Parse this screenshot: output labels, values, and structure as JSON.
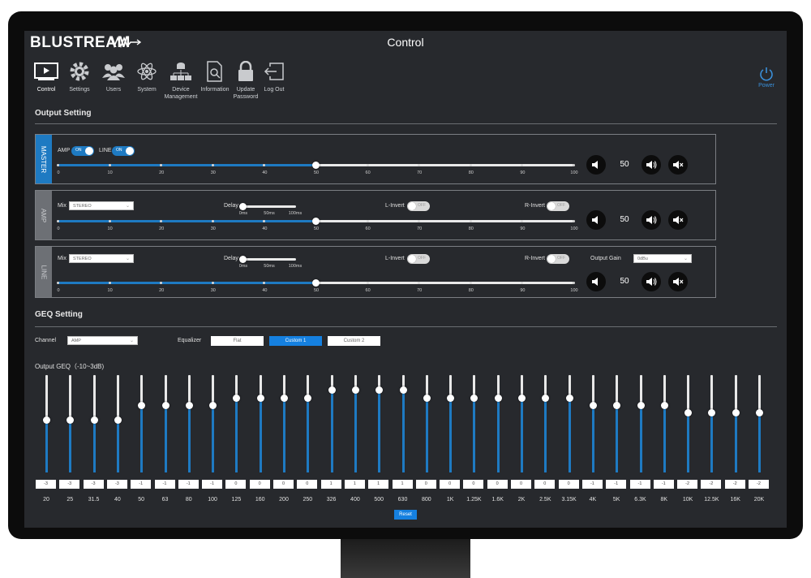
{
  "app": {
    "logo": "BLUSTREAM",
    "title": "Control"
  },
  "nav": [
    {
      "label": "Control",
      "icon": "monitor-play-icon"
    },
    {
      "label": "Settings",
      "icon": "gear-icon"
    },
    {
      "label": "Users",
      "icon": "users-icon"
    },
    {
      "label": "System",
      "icon": "atom-icon"
    },
    {
      "label": "Device Management",
      "icon": "network-icon"
    },
    {
      "label": "Information",
      "icon": "document-search-icon"
    },
    {
      "label": "Update Password",
      "icon": "lock-icon"
    },
    {
      "label": "Log Out",
      "icon": "logout-icon"
    }
  ],
  "power": {
    "label": "Power",
    "icon": "power-icon"
  },
  "output_setting": {
    "title": "Output Setting",
    "scale_ticks": [
      "0",
      "10",
      "20",
      "30",
      "40",
      "50",
      "60",
      "70",
      "80",
      "90",
      "100"
    ],
    "master": {
      "tab": "MASTER",
      "amp_label": "AMP",
      "amp_toggle": "ON",
      "line_label": "LINE",
      "line_toggle": "ON",
      "volume": "50"
    },
    "amp": {
      "tab": "AMP",
      "mix_label": "Mix",
      "mix_value": "STEREO",
      "delay_label": "Delay",
      "delay_ticks": [
        "0ms",
        "50ms",
        "100ms"
      ],
      "l_invert_label": "L-Invert",
      "l_invert_toggle": "OFF",
      "r_invert_label": "R-Invert",
      "r_invert_toggle": "OFF",
      "volume": "50"
    },
    "line": {
      "tab": "LINE",
      "mix_label": "Mix",
      "mix_value": "STEREO",
      "delay_label": "Delay",
      "delay_ticks": [
        "0ms",
        "50ms",
        "100ms"
      ],
      "l_invert_label": "L-Invert",
      "l_invert_toggle": "OFF",
      "r_invert_label": "R-Invert",
      "r_invert_toggle": "OFF",
      "output_gain_label": "Output Gain",
      "output_gain_value": "0dBu",
      "volume": "50"
    }
  },
  "geq": {
    "title": "GEQ Setting",
    "channel_label": "Channel",
    "channel_value": "AMP",
    "equalizer_label": "Equalizer",
    "presets": [
      "Flat",
      "Custom 1",
      "Custom 2"
    ],
    "active_preset": "Custom 1",
    "output_label": "Output GEQ（-10~3dB)",
    "bands": [
      {
        "freq": "20",
        "value": "-3"
      },
      {
        "freq": "25",
        "value": "-3"
      },
      {
        "freq": "31.5",
        "value": "-3"
      },
      {
        "freq": "40",
        "value": "-3"
      },
      {
        "freq": "50",
        "value": "-1"
      },
      {
        "freq": "63",
        "value": "-1"
      },
      {
        "freq": "80",
        "value": "-1"
      },
      {
        "freq": "100",
        "value": "-1"
      },
      {
        "freq": "125",
        "value": "0"
      },
      {
        "freq": "160",
        "value": "0"
      },
      {
        "freq": "200",
        "value": "0"
      },
      {
        "freq": "250",
        "value": "0"
      },
      {
        "freq": "326",
        "value": "1"
      },
      {
        "freq": "400",
        "value": "1"
      },
      {
        "freq": "500",
        "value": "1"
      },
      {
        "freq": "630",
        "value": "1"
      },
      {
        "freq": "800",
        "value": "0"
      },
      {
        "freq": "1K",
        "value": "0"
      },
      {
        "freq": "1.25K",
        "value": "0"
      },
      {
        "freq": "1.6K",
        "value": "0"
      },
      {
        "freq": "2K",
        "value": "0"
      },
      {
        "freq": "2.5K",
        "value": "0"
      },
      {
        "freq": "3.15K",
        "value": "0"
      },
      {
        "freq": "4K",
        "value": "-1"
      },
      {
        "freq": "5K",
        "value": "-1"
      },
      {
        "freq": "6.3K",
        "value": "-1"
      },
      {
        "freq": "8K",
        "value": "-1"
      },
      {
        "freq": "10K",
        "value": "-2"
      },
      {
        "freq": "12.5K",
        "value": "-2"
      },
      {
        "freq": "16K",
        "value": "-2"
      },
      {
        "freq": "20K",
        "value": "-2"
      }
    ],
    "reset_label": "Reset"
  },
  "colors": {
    "accent": "#1e7ac2",
    "button_active": "#1580e0",
    "background": "#27292d",
    "power": "#3a8fd9"
  }
}
